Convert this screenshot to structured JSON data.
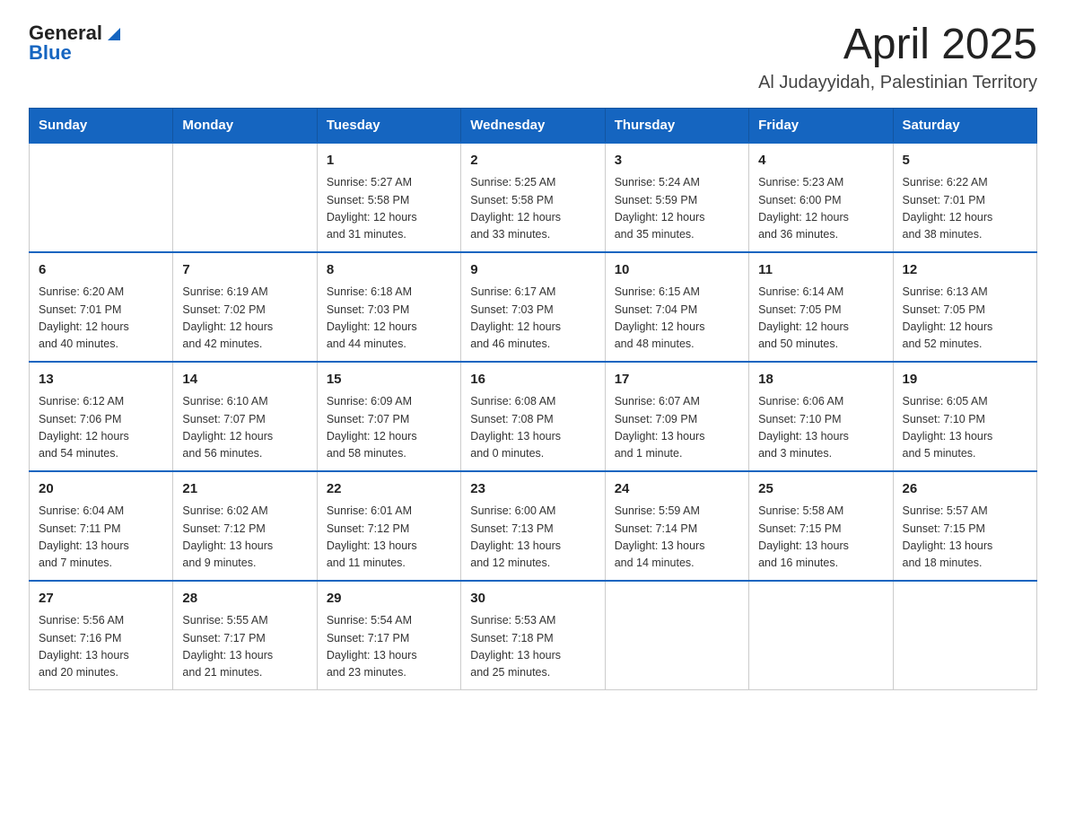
{
  "logo": {
    "general": "General",
    "blue": "Blue"
  },
  "title": "April 2025",
  "subtitle": "Al Judayyidah, Palestinian Territory",
  "weekdays": [
    "Sunday",
    "Monday",
    "Tuesday",
    "Wednesday",
    "Thursday",
    "Friday",
    "Saturday"
  ],
  "weeks": [
    [
      {
        "day": "",
        "info": ""
      },
      {
        "day": "",
        "info": ""
      },
      {
        "day": "1",
        "info": "Sunrise: 5:27 AM\nSunset: 5:58 PM\nDaylight: 12 hours\nand 31 minutes."
      },
      {
        "day": "2",
        "info": "Sunrise: 5:25 AM\nSunset: 5:58 PM\nDaylight: 12 hours\nand 33 minutes."
      },
      {
        "day": "3",
        "info": "Sunrise: 5:24 AM\nSunset: 5:59 PM\nDaylight: 12 hours\nand 35 minutes."
      },
      {
        "day": "4",
        "info": "Sunrise: 5:23 AM\nSunset: 6:00 PM\nDaylight: 12 hours\nand 36 minutes."
      },
      {
        "day": "5",
        "info": "Sunrise: 6:22 AM\nSunset: 7:01 PM\nDaylight: 12 hours\nand 38 minutes."
      }
    ],
    [
      {
        "day": "6",
        "info": "Sunrise: 6:20 AM\nSunset: 7:01 PM\nDaylight: 12 hours\nand 40 minutes."
      },
      {
        "day": "7",
        "info": "Sunrise: 6:19 AM\nSunset: 7:02 PM\nDaylight: 12 hours\nand 42 minutes."
      },
      {
        "day": "8",
        "info": "Sunrise: 6:18 AM\nSunset: 7:03 PM\nDaylight: 12 hours\nand 44 minutes."
      },
      {
        "day": "9",
        "info": "Sunrise: 6:17 AM\nSunset: 7:03 PM\nDaylight: 12 hours\nand 46 minutes."
      },
      {
        "day": "10",
        "info": "Sunrise: 6:15 AM\nSunset: 7:04 PM\nDaylight: 12 hours\nand 48 minutes."
      },
      {
        "day": "11",
        "info": "Sunrise: 6:14 AM\nSunset: 7:05 PM\nDaylight: 12 hours\nand 50 minutes."
      },
      {
        "day": "12",
        "info": "Sunrise: 6:13 AM\nSunset: 7:05 PM\nDaylight: 12 hours\nand 52 minutes."
      }
    ],
    [
      {
        "day": "13",
        "info": "Sunrise: 6:12 AM\nSunset: 7:06 PM\nDaylight: 12 hours\nand 54 minutes."
      },
      {
        "day": "14",
        "info": "Sunrise: 6:10 AM\nSunset: 7:07 PM\nDaylight: 12 hours\nand 56 minutes."
      },
      {
        "day": "15",
        "info": "Sunrise: 6:09 AM\nSunset: 7:07 PM\nDaylight: 12 hours\nand 58 minutes."
      },
      {
        "day": "16",
        "info": "Sunrise: 6:08 AM\nSunset: 7:08 PM\nDaylight: 13 hours\nand 0 minutes."
      },
      {
        "day": "17",
        "info": "Sunrise: 6:07 AM\nSunset: 7:09 PM\nDaylight: 13 hours\nand 1 minute."
      },
      {
        "day": "18",
        "info": "Sunrise: 6:06 AM\nSunset: 7:10 PM\nDaylight: 13 hours\nand 3 minutes."
      },
      {
        "day": "19",
        "info": "Sunrise: 6:05 AM\nSunset: 7:10 PM\nDaylight: 13 hours\nand 5 minutes."
      }
    ],
    [
      {
        "day": "20",
        "info": "Sunrise: 6:04 AM\nSunset: 7:11 PM\nDaylight: 13 hours\nand 7 minutes."
      },
      {
        "day": "21",
        "info": "Sunrise: 6:02 AM\nSunset: 7:12 PM\nDaylight: 13 hours\nand 9 minutes."
      },
      {
        "day": "22",
        "info": "Sunrise: 6:01 AM\nSunset: 7:12 PM\nDaylight: 13 hours\nand 11 minutes."
      },
      {
        "day": "23",
        "info": "Sunrise: 6:00 AM\nSunset: 7:13 PM\nDaylight: 13 hours\nand 12 minutes."
      },
      {
        "day": "24",
        "info": "Sunrise: 5:59 AM\nSunset: 7:14 PM\nDaylight: 13 hours\nand 14 minutes."
      },
      {
        "day": "25",
        "info": "Sunrise: 5:58 AM\nSunset: 7:15 PM\nDaylight: 13 hours\nand 16 minutes."
      },
      {
        "day": "26",
        "info": "Sunrise: 5:57 AM\nSunset: 7:15 PM\nDaylight: 13 hours\nand 18 minutes."
      }
    ],
    [
      {
        "day": "27",
        "info": "Sunrise: 5:56 AM\nSunset: 7:16 PM\nDaylight: 13 hours\nand 20 minutes."
      },
      {
        "day": "28",
        "info": "Sunrise: 5:55 AM\nSunset: 7:17 PM\nDaylight: 13 hours\nand 21 minutes."
      },
      {
        "day": "29",
        "info": "Sunrise: 5:54 AM\nSunset: 7:17 PM\nDaylight: 13 hours\nand 23 minutes."
      },
      {
        "day": "30",
        "info": "Sunrise: 5:53 AM\nSunset: 7:18 PM\nDaylight: 13 hours\nand 25 minutes."
      },
      {
        "day": "",
        "info": ""
      },
      {
        "day": "",
        "info": ""
      },
      {
        "day": "",
        "info": ""
      }
    ]
  ]
}
